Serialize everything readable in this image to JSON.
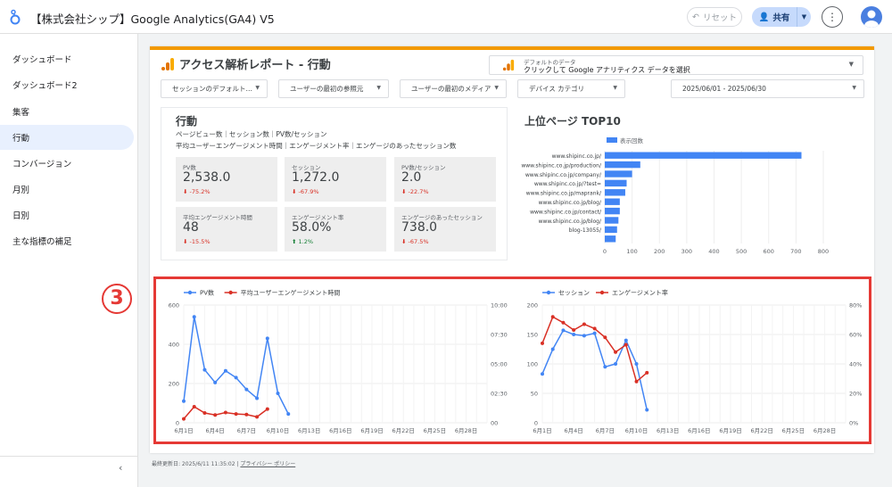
{
  "app": {
    "title": "【株式会社シップ】Google Analytics(GA4) V5",
    "reset_label": "リセット",
    "share_label": "共有"
  },
  "sidebar": {
    "items": [
      {
        "label": "ダッシュボード",
        "active": false
      },
      {
        "label": "ダッシュボード2",
        "active": false
      },
      {
        "label": "集客",
        "active": false
      },
      {
        "label": "行動",
        "active": true
      },
      {
        "label": "コンバージョン",
        "active": false
      },
      {
        "label": "月別",
        "active": false
      },
      {
        "label": "日別",
        "active": false
      },
      {
        "label": "主な指標の補足",
        "active": false
      }
    ]
  },
  "report": {
    "title": "アクセス解析レポート - 行動",
    "datasource_label": "デフォルトのデータ",
    "datasource_value": "クリックして Google アナリティクス データを選択",
    "filters": [
      "セッションのデフォルト…",
      "ユーザーの最初の参照元",
      "ユーザーの最初のメディア",
      "デバイス カテゴリ",
      "2025/06/01 - 2025/06/30"
    ]
  },
  "kpi": {
    "heading": "行動",
    "sub1": "ページビュー数｜セッション数｜PV数/セッション",
    "sub2": "平均ユーザーエンゲージメント時間｜エンゲージメント率｜エンゲージのあったセッション数",
    "cards": [
      {
        "label": "PV数",
        "value": "2,538.0",
        "change": "-75.2%",
        "dir": "down"
      },
      {
        "label": "セッション",
        "value": "1,272.0",
        "change": "-67.9%",
        "dir": "down"
      },
      {
        "label": "PV数/セッション",
        "value": "2.0",
        "change": "-22.7%",
        "dir": "down"
      },
      {
        "label": "平均エンゲージメント時間",
        "value": "48",
        "change": "-15.5%",
        "dir": "down"
      },
      {
        "label": "エンゲージメント率",
        "value": "58.0%",
        "change": "1.2%",
        "dir": "up"
      },
      {
        "label": "エンゲージのあったセッション",
        "value": "738.0",
        "change": "-67.5%",
        "dir": "down"
      }
    ]
  },
  "top_pages": {
    "title": "上位ページ TOP10"
  },
  "annotation": {
    "number": "3"
  },
  "footer": {
    "updated": "最終更新日: 2025/6/11 11:35:02",
    "privacy": "プライバシー ポリシー"
  },
  "colors": {
    "accent_orange": "#f29900",
    "blue": "#4285f4",
    "red": "#d93025",
    "annotation": "#e53935"
  },
  "chart_data": [
    {
      "type": "bar",
      "orientation": "horizontal",
      "title": "上位ページ TOP10",
      "legend": [
        "表示回数"
      ],
      "categories": [
        "www.shipinc.co.jp/",
        "www.shipinc.co.jp/production/",
        "www.shipinc.co.jp/company/",
        "www.shipinc.co.jp/?test=",
        "www.shipinc.co.jp/maprank/",
        "www.shipinc.co.jp/blog/",
        "www.shipinc.co.jp/contact/",
        "www.shipinc.co.jp/blog/",
        "blog-13055/",
        ""
      ],
      "values": [
        720,
        130,
        100,
        80,
        75,
        55,
        55,
        50,
        45,
        40
      ],
      "xlim": [
        0,
        800
      ],
      "xticks": [
        "0",
        "100",
        "200",
        "300",
        "400",
        "500",
        "600",
        "700",
        "800"
      ]
    },
    {
      "type": "line",
      "legend_position": "top-left",
      "x": [
        "6月1日",
        "6月2日",
        "6月3日",
        "6月4日",
        "6月5日",
        "6月6日",
        "6月7日",
        "6月8日",
        "6月9日",
        "6月10日",
        "6月11日"
      ],
      "xticks": [
        "6月1日",
        "6月4日",
        "6月7日",
        "6月10日",
        "6月13日",
        "6月16日",
        "6月19日",
        "6月22日",
        "6月25日",
        "6月28日"
      ],
      "series": [
        {
          "name": "PV数",
          "axis": "left",
          "color": "#4285f4",
          "values": [
            110,
            540,
            270,
            205,
            265,
            230,
            170,
            125,
            430,
            150,
            45
          ]
        },
        {
          "name": "平均ユーザーエンゲージメント時間",
          "axis": "right",
          "color": "#d93025",
          "values": [
            20,
            82,
            50,
            40,
            52,
            45,
            42,
            30,
            70,
            null,
            null
          ]
        }
      ],
      "ylim_left": [
        0,
        600
      ],
      "yticks_left": [
        "0",
        "200",
        "400",
        "600"
      ],
      "ylim_right": [
        0,
        600
      ],
      "yticks_right": [
        "00",
        "02:30",
        "05:00",
        "07:30",
        "10:00"
      ]
    },
    {
      "type": "line",
      "legend_position": "top-left",
      "x": [
        "6月1日",
        "6月2日",
        "6月3日",
        "6月4日",
        "6月5日",
        "6月6日",
        "6月7日",
        "6月8日",
        "6月9日",
        "6月10日",
        "6月11日"
      ],
      "xticks": [
        "6月1日",
        "6月4日",
        "6月7日",
        "6月10日",
        "6月13日",
        "6月16日",
        "6月19日",
        "6月22日",
        "6月25日",
        "6月28日"
      ],
      "series": [
        {
          "name": "セッション",
          "axis": "left",
          "color": "#4285f4",
          "values": [
            83,
            125,
            157,
            150,
            148,
            152,
            95,
            100,
            140,
            100,
            22
          ]
        },
        {
          "name": "エンゲージメント率",
          "axis": "right",
          "color": "#d93025",
          "values": [
            54,
            72,
            68,
            63,
            67,
            64,
            58,
            48,
            53,
            28,
            34
          ]
        }
      ],
      "ylim_left": [
        0,
        200
      ],
      "yticks_left": [
        "0",
        "50",
        "100",
        "150",
        "200"
      ],
      "ylim_right": [
        0,
        80
      ],
      "yticks_right": [
        "0%",
        "20%",
        "40%",
        "60%",
        "80%"
      ]
    }
  ]
}
